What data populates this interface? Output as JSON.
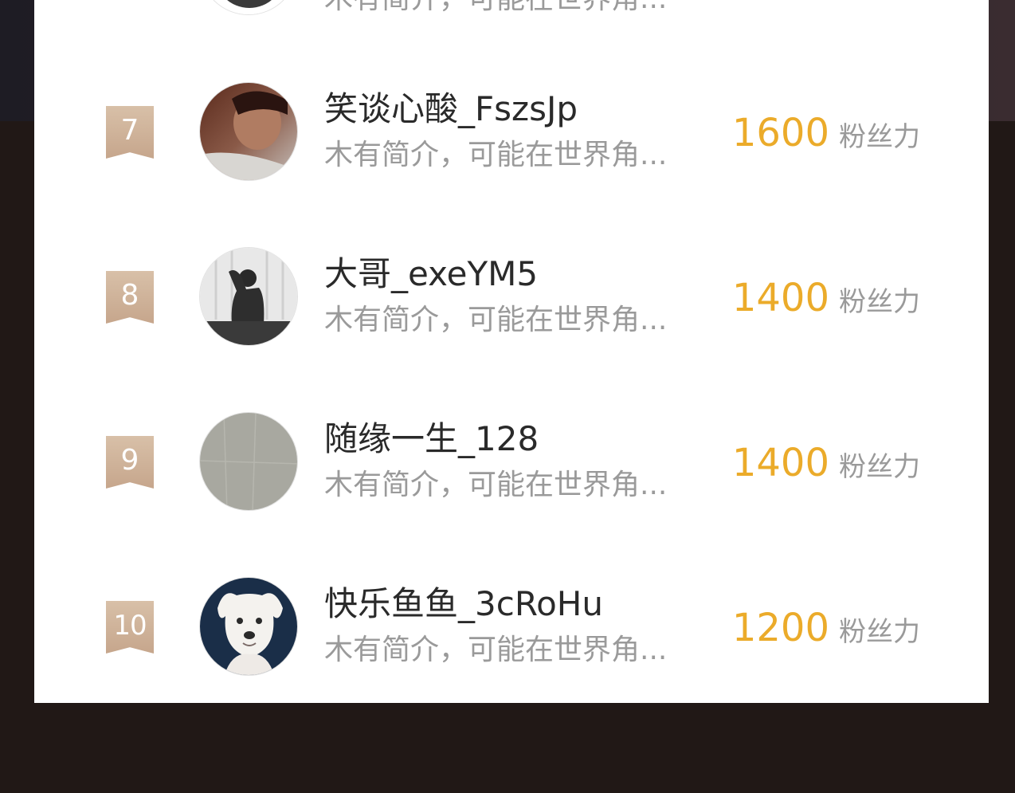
{
  "ranking": {
    "partial_row": {
      "bio": "木有简介，可能在世界角..."
    },
    "rows": [
      {
        "rank": "7",
        "name": "笑谈心酸_FszsJp",
        "bio": "木有简介，可能在世界角...",
        "score": "1600",
        "unit": "粉丝力",
        "avatar": "man-portrait-avatar"
      },
      {
        "rank": "8",
        "name": "大哥_exeYM5",
        "bio": "木有简介，可能在世界角...",
        "score": "1400",
        "unit": "粉丝力",
        "avatar": "silhouette-avatar"
      },
      {
        "rank": "9",
        "name": "随缘一生_128",
        "bio": "木有简介，可能在世界角...",
        "score": "1400",
        "unit": "粉丝力",
        "avatar": "gray-wall-avatar"
      },
      {
        "rank": "10",
        "name": "快乐鱼鱼_3cRoHu",
        "bio": "木有简介，可能在世界角...",
        "score": "1200",
        "unit": "粉丝力",
        "avatar": "white-dog-avatar"
      }
    ]
  },
  "colors": {
    "score": "#ebab2a",
    "badge": "#c6a68c",
    "name": "#2a2a2a",
    "bio": "#9a9a9a",
    "background": "#211816"
  }
}
